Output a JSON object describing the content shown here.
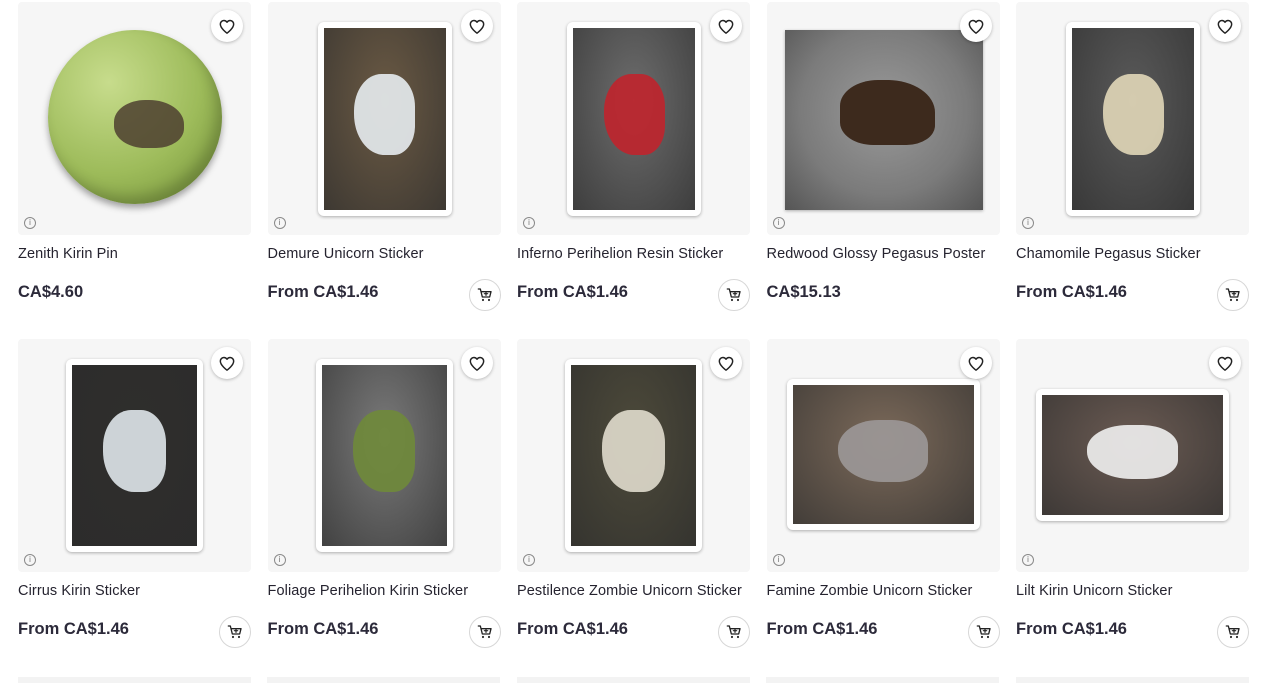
{
  "products": [
    {
      "title": "Zenith Kirin Pin",
      "price": "CA$4.60",
      "cart": false,
      "type": "pin",
      "colors": [
        "#9dbb5a",
        "#4d4030"
      ]
    },
    {
      "title": "Demure Unicorn Sticker",
      "price": "From CA$1.46",
      "cart": true,
      "type": "sticker-portrait",
      "colors": [
        "#6b5a44",
        "#e7ecef"
      ]
    },
    {
      "title": "Inferno Perihelion Resin Sticker",
      "price": "From CA$1.46",
      "cart": true,
      "type": "sticker-portrait",
      "colors": [
        "#6d6d6d",
        "#c0242c"
      ]
    },
    {
      "title": "Redwood Glossy Pegasus Poster",
      "price": "CA$15.13",
      "cart": false,
      "type": "poster",
      "colors": [
        "#7b7b7b",
        "#3d2a1d"
      ]
    },
    {
      "title": "Chamomile Pegasus Sticker",
      "price": "From CA$1.46",
      "cart": true,
      "type": "sticker-portrait",
      "colors": [
        "#5a5a5a",
        "#e1d7b8"
      ]
    },
    {
      "title": "Cirrus Kirin Sticker",
      "price": "From CA$1.46",
      "cart": true,
      "type": "sticker-tall",
      "colors": [
        "#2f2e2c",
        "#dfe6ea"
      ]
    },
    {
      "title": "Foliage Perihelion Kirin Sticker",
      "price": "From CA$1.46",
      "cart": true,
      "type": "sticker-tall",
      "colors": [
        "#7a7a7a",
        "#6f8a3a"
      ]
    },
    {
      "title": "Pestilence Zombie Unicorn Sticker",
      "price": "From CA$1.46",
      "cart": true,
      "type": "sticker-tall",
      "colors": [
        "#4d4a3a",
        "#e0dccd"
      ]
    },
    {
      "title": "Famine Zombie Unicorn Sticker",
      "price": "From CA$1.46",
      "cart": true,
      "type": "sticker-landscape",
      "colors": [
        "#7c6a5a",
        "#9c9898"
      ]
    },
    {
      "title": "Lilt Kirin Unicorn Sticker",
      "price": "From CA$1.46",
      "cart": true,
      "type": "sticker-landscape-small",
      "colors": [
        "#6b5b53",
        "#f0f0f0"
      ]
    }
  ],
  "icons": {
    "favorite": "heart-icon",
    "cart": "add-to-cart-icon",
    "info": "info-icon"
  },
  "info_glyph": "i"
}
